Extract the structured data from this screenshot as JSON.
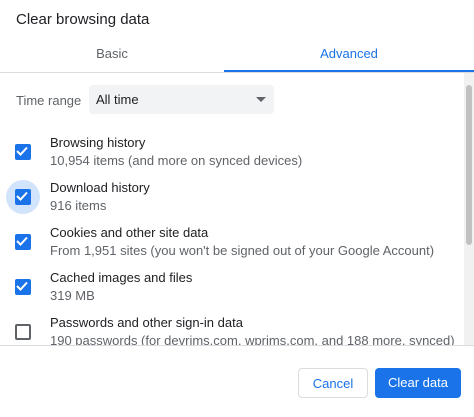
{
  "dialog": {
    "title": "Clear browsing data",
    "tabs": [
      {
        "label": "Basic",
        "active": false
      },
      {
        "label": "Advanced",
        "active": true
      }
    ],
    "time_range": {
      "label": "Time range",
      "value": "All time"
    },
    "items": [
      {
        "label": "Browsing history",
        "sub": "10,954 items (and more on synced devices)",
        "checked": true,
        "focused": false
      },
      {
        "label": "Download history",
        "sub": "916 items",
        "checked": true,
        "focused": true
      },
      {
        "label": "Cookies and other site data",
        "sub": "From 1,951 sites (you won't be signed out of your Google Account)",
        "checked": true,
        "focused": false
      },
      {
        "label": "Cached images and files",
        "sub": "319 MB",
        "checked": true,
        "focused": false
      },
      {
        "label": "Passwords and other sign-in data",
        "sub": "190 passwords (for devrims.com, wprims.com, and 188 more, synced)",
        "checked": false,
        "focused": false
      }
    ],
    "buttons": {
      "cancel": "Cancel",
      "clear": "Clear data"
    },
    "colors": {
      "accent": "#1a73e8",
      "focus_ring": "#d2e3fc",
      "text_secondary": "#5f6368"
    }
  }
}
